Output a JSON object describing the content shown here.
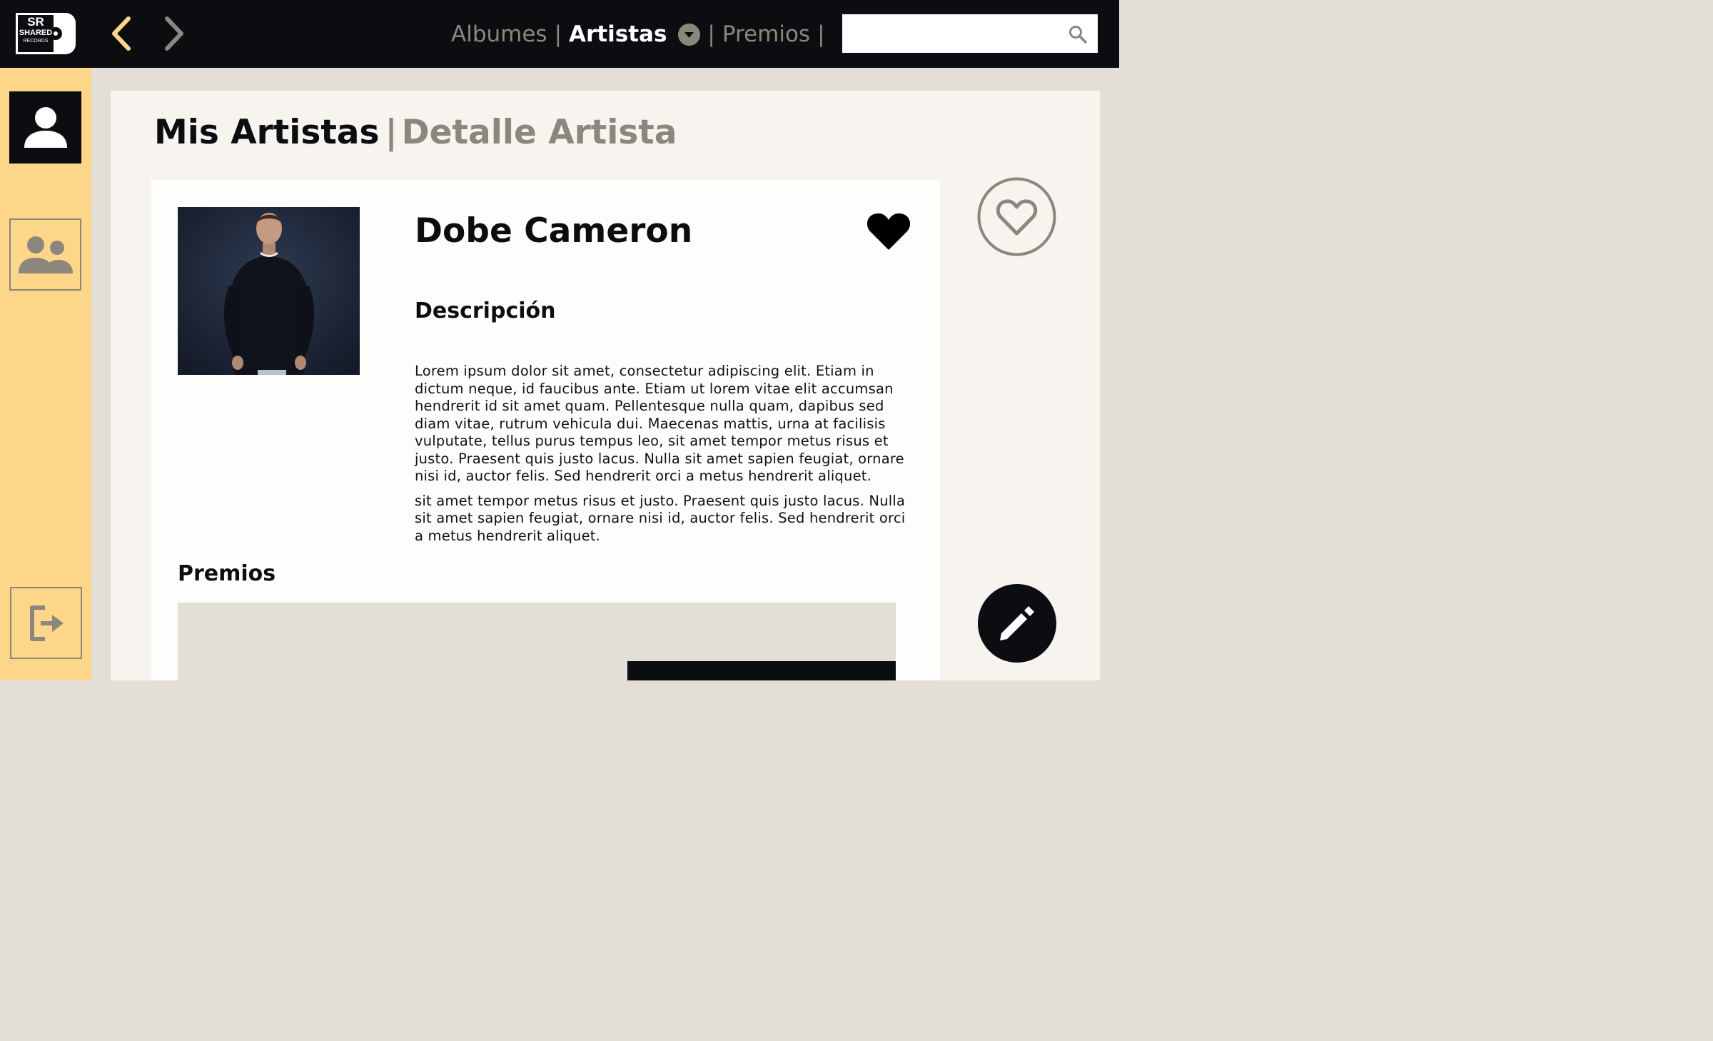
{
  "app": {
    "logo_text_top": "SR",
    "logo_text_mid": "SHARED",
    "logo_text_bottom": "RECORDS"
  },
  "topnav": {
    "items": [
      {
        "label": "Albumes"
      },
      {
        "label": "Artistas"
      },
      {
        "label": "Premios"
      }
    ],
    "separator": "|"
  },
  "search": {
    "value": "",
    "placeholder": ""
  },
  "sidebar": {
    "items": [
      {
        "name": "mis-artistas",
        "icon": "person-icon",
        "active": true
      },
      {
        "name": "artistas",
        "icon": "people-icon",
        "active": false
      },
      {
        "name": "logout",
        "icon": "logout-icon",
        "active": false
      }
    ]
  },
  "breadcrumb": {
    "parent": "Mis Artistas",
    "separator": "|",
    "current": "Detalle Artista"
  },
  "artist": {
    "name": "Dobe Cameron",
    "description_title": "Descripción",
    "description_p1": "Lorem ipsum dolor sit amet, consectetur adipiscing elit. Etiam in dictum neque, id faucibus ante. Etiam ut lorem vitae elit accumsan hendrerit id sit amet quam. Pellentesque nulla quam, dapibus sed diam vitae, rutrum vehicula dui. Maecenas mattis, urna at facilisis vulputate, tellus purus tempus leo, sit amet tempor metus risus et justo. Praesent quis justo lacus. Nulla sit amet sapien feugiat, ornare nisi id, auctor felis. Sed hendrerit orci a metus hendrerit aliquet.",
    "description_p2": "sit amet tempor metus risus et justo. Praesent quis justo lacus. Nulla sit amet sapien feugiat, ornare nisi id, auctor felis. Sed hendrerit orci a metus hendrerit aliquet.",
    "awards_title": "Premios",
    "favorite": true
  },
  "colors": {
    "topbar": "#0b0d10",
    "sidebar": "#fdd68a",
    "accent_arrow": "#fdd68a",
    "muted": "#8b877c",
    "panel": "#f7f3ee",
    "card": "#fdfdfc"
  }
}
